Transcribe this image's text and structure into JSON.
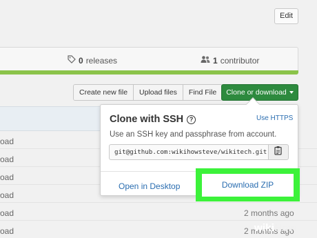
{
  "toolbar": {
    "edit_label": "Edit"
  },
  "summary": {
    "releases_count": "0",
    "releases_label": "releases",
    "contributors_count": "1",
    "contributors_label": "contributor"
  },
  "actions": {
    "create_new_file": "Create new file",
    "upload_files": "Upload files",
    "find_file": "Find File",
    "clone_or_download": "Clone or download"
  },
  "clone_popup": {
    "title": "Clone with SSH",
    "use_https": "Use HTTPS",
    "description": "Use an SSH key and passphrase from account.",
    "url": "git@github.com:wikihowsteve/wikitech.git",
    "open_in_desktop": "Open in Desktop",
    "download_zip": "Download ZIP"
  },
  "file_rows": [
    {
      "text": "oad"
    },
    {
      "text": "oad"
    },
    {
      "text": "oad"
    },
    {
      "text": "oad"
    },
    {
      "text": "oad",
      "age": "2 months ago"
    },
    {
      "text": "oad",
      "age": "2 months ago"
    }
  ],
  "watermark": {
    "part1": "wiki",
    "part2": "How"
  },
  "colors": {
    "clone_button": "#2d8a3e",
    "highlight": "#3cf23a",
    "link": "#2a6db0",
    "language_bar": "#8bc34a"
  },
  "icons": {
    "releases": "tag-icon",
    "contributors": "people-icon",
    "help": "question-circle-icon",
    "copy": "clipboard-icon",
    "caret": "caret-down-icon"
  }
}
